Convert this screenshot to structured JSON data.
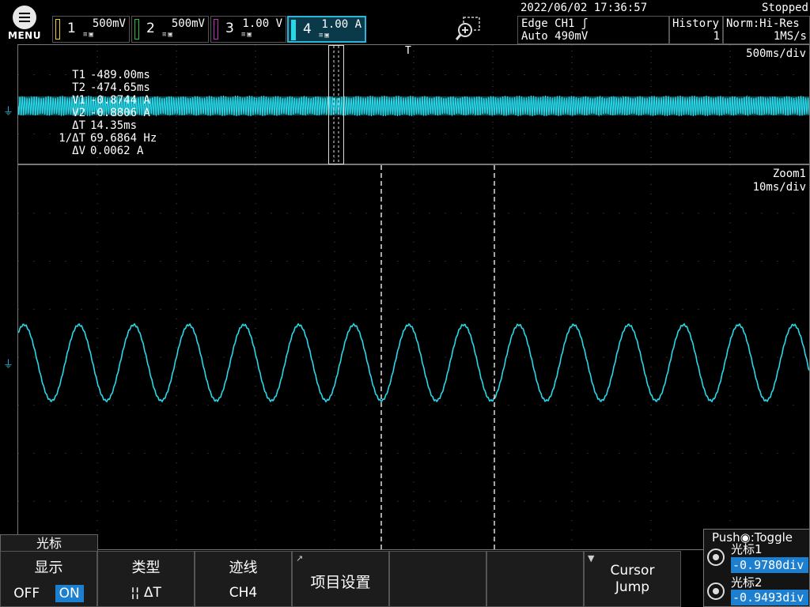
{
  "menu": {
    "label": "MENU"
  },
  "channels": [
    {
      "num": "1",
      "value": "500mV",
      "color": "#f0d020",
      "active": false
    },
    {
      "num": "2",
      "value": "500mV",
      "color": "#28c040",
      "active": false
    },
    {
      "num": "3",
      "value": "1.00 V",
      "color": "#c030c0",
      "active": false
    },
    {
      "num": "4",
      "value": "1.00 A",
      "color": "#29d8e8",
      "active": true
    }
  ],
  "datetime": "2022/06/02 17:36:57",
  "status": "Stopped",
  "trigger": {
    "line1": "Edge CH1 ʃ",
    "line2": "Auto 490mV"
  },
  "history": {
    "label": "History",
    "count": "1"
  },
  "acquisition": {
    "mode": "Norm:Hi-Res",
    "rate": "1MS/s"
  },
  "main_timebase": "500ms/div",
  "zoom": {
    "label": "Zoom1",
    "timebase": "10ms/div"
  },
  "trigger_marker": "T",
  "ground_marker": "⏚",
  "cursor_readout": [
    {
      "k": "T1",
      "v": "-489.00ms"
    },
    {
      "k": "T2",
      "v": "-474.65ms"
    },
    {
      "k": "V1",
      "v": "-0.8744 A"
    },
    {
      "k": "V2",
      "v": "-0.8806 A"
    },
    {
      "k": "ΔT",
      "v": "14.35ms"
    },
    {
      "k": "1/ΔT",
      "v": "69.6864 Hz"
    },
    {
      "k": "ΔV",
      "v": "0.0062 A"
    }
  ],
  "softkeys": {
    "tab": "光标",
    "display": {
      "title": "显示",
      "off": "OFF",
      "on": "ON"
    },
    "type": {
      "title": "类型",
      "value": "¦¦ ΔT"
    },
    "trace": {
      "title": "迹线",
      "value": "CH4"
    },
    "items": {
      "title": "项目设置"
    },
    "jump": {
      "line1": "Cursor",
      "line2": "Jump"
    }
  },
  "push_panel": {
    "header": "Push◉:Toggle",
    "c1_label": "光标1",
    "c1_value": "-0.9780div",
    "c2_label": "光标2",
    "c2_value": "-0.9493div"
  },
  "colors": {
    "trace": "#29d8e8",
    "highlight": "#1c7fd0"
  },
  "waveform": {
    "zoom_period_div": 0.695,
    "amplitude_a": 0.5
  }
}
